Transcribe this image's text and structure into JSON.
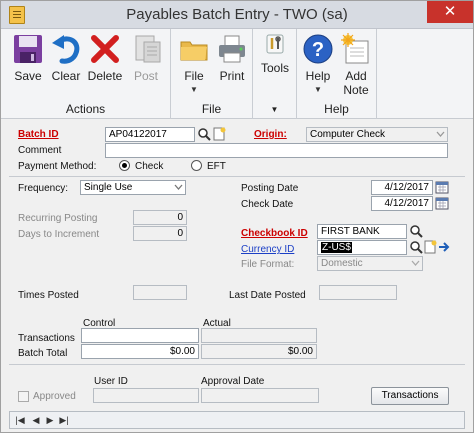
{
  "window": {
    "title": "Payables Batch Entry  -  TWO (sa)",
    "close_glyph": "✕"
  },
  "ribbon": {
    "actions": {
      "label": "Actions",
      "save": "Save",
      "clear": "Clear",
      "delete": "Delete",
      "post": "Post"
    },
    "file": {
      "label": "File",
      "file": "File",
      "print": "Print"
    },
    "tools": {
      "label": "",
      "tools": "Tools"
    },
    "help": {
      "label": "Help",
      "help": "Help",
      "add_note": "Add\nNote"
    }
  },
  "form": {
    "batch_id_label": "Batch ID",
    "batch_id": "AP04122017",
    "origin_label": "Origin:",
    "origin": "Computer Check",
    "comment_label": "Comment",
    "comment": "",
    "payment_method_label": "Payment Method:",
    "payment_check": "Check",
    "payment_eft": "EFT",
    "frequency_label": "Frequency:",
    "frequency": "Single Use",
    "posting_date_label": "Posting Date",
    "posting_date": "4/12/2017",
    "check_date_label": "Check Date",
    "check_date": "4/12/2017",
    "recurring_posting_label": "Recurring Posting",
    "recurring_posting": "0",
    "days_to_increment_label": "Days to Increment",
    "days_to_increment": "0",
    "checkbook_id_label": "Checkbook ID",
    "checkbook_id": "FIRST BANK",
    "currency_id_label": "Currency ID",
    "currency_id": "Z-US$",
    "file_format_label": "File Format:",
    "file_format": "Domestic",
    "times_posted_label": "Times Posted",
    "last_date_posted_label": "Last Date Posted",
    "control_label": "Control",
    "actual_label": "Actual",
    "transactions_label": "Transactions",
    "batch_total_label": "Batch Total",
    "control_total": "$0.00",
    "actual_total": "$0.00",
    "approved_label": "Approved",
    "user_id_label": "User ID",
    "approval_date_label": "Approval Date",
    "transactions_button": "Transactions"
  },
  "navbar": {
    "first": "|◀",
    "prev": "◀",
    "next": "▶",
    "last": "▶|"
  }
}
